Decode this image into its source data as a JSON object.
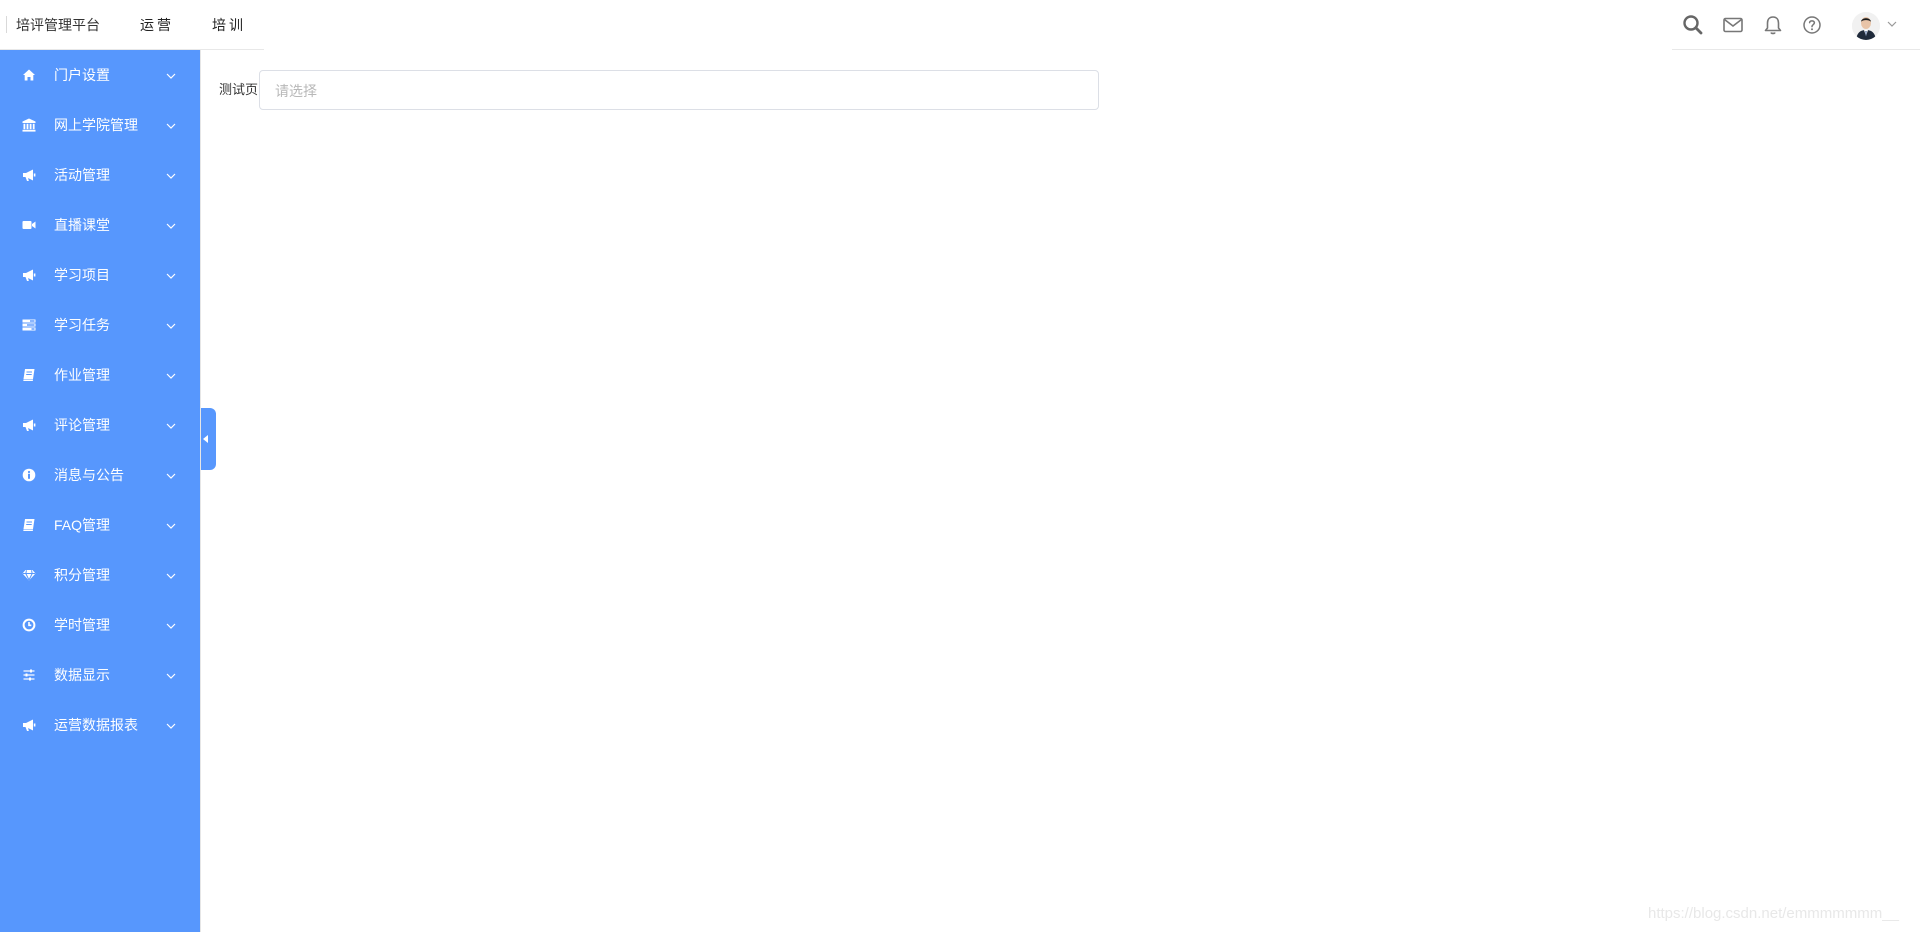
{
  "header": {
    "brand": "培评管理平台",
    "nav": [
      "运营",
      "培训"
    ],
    "icons": [
      "search-icon",
      "mail-icon",
      "bell-icon",
      "help-icon"
    ],
    "avatar_alt": ""
  },
  "sidebar": {
    "bg_color": "#5797fd",
    "items": [
      {
        "label": "门户设置",
        "icon": "home-icon"
      },
      {
        "label": "网上学院管理",
        "icon": "institution-icon"
      },
      {
        "label": "活动管理",
        "icon": "megaphone-icon"
      },
      {
        "label": "直播课堂",
        "icon": "video-icon"
      },
      {
        "label": "学习项目",
        "icon": "megaphone-icon"
      },
      {
        "label": "学习任务",
        "icon": "tasks-icon"
      },
      {
        "label": "作业管理",
        "icon": "book-icon"
      },
      {
        "label": "评论管理",
        "icon": "megaphone-icon"
      },
      {
        "label": "消息与公告",
        "icon": "info-icon"
      },
      {
        "label": "FAQ管理",
        "icon": "book-icon"
      },
      {
        "label": "积分管理",
        "icon": "diamond-icon"
      },
      {
        "label": "学时管理",
        "icon": "clock-icon"
      },
      {
        "label": "数据显示",
        "icon": "sliders-icon"
      },
      {
        "label": "运营数据报表",
        "icon": "megaphone-icon"
      }
    ]
  },
  "main": {
    "field_label": "测试页",
    "select_placeholder": "请选择"
  },
  "watermark": "https://blog.csdn.net/emmmmmmm__"
}
